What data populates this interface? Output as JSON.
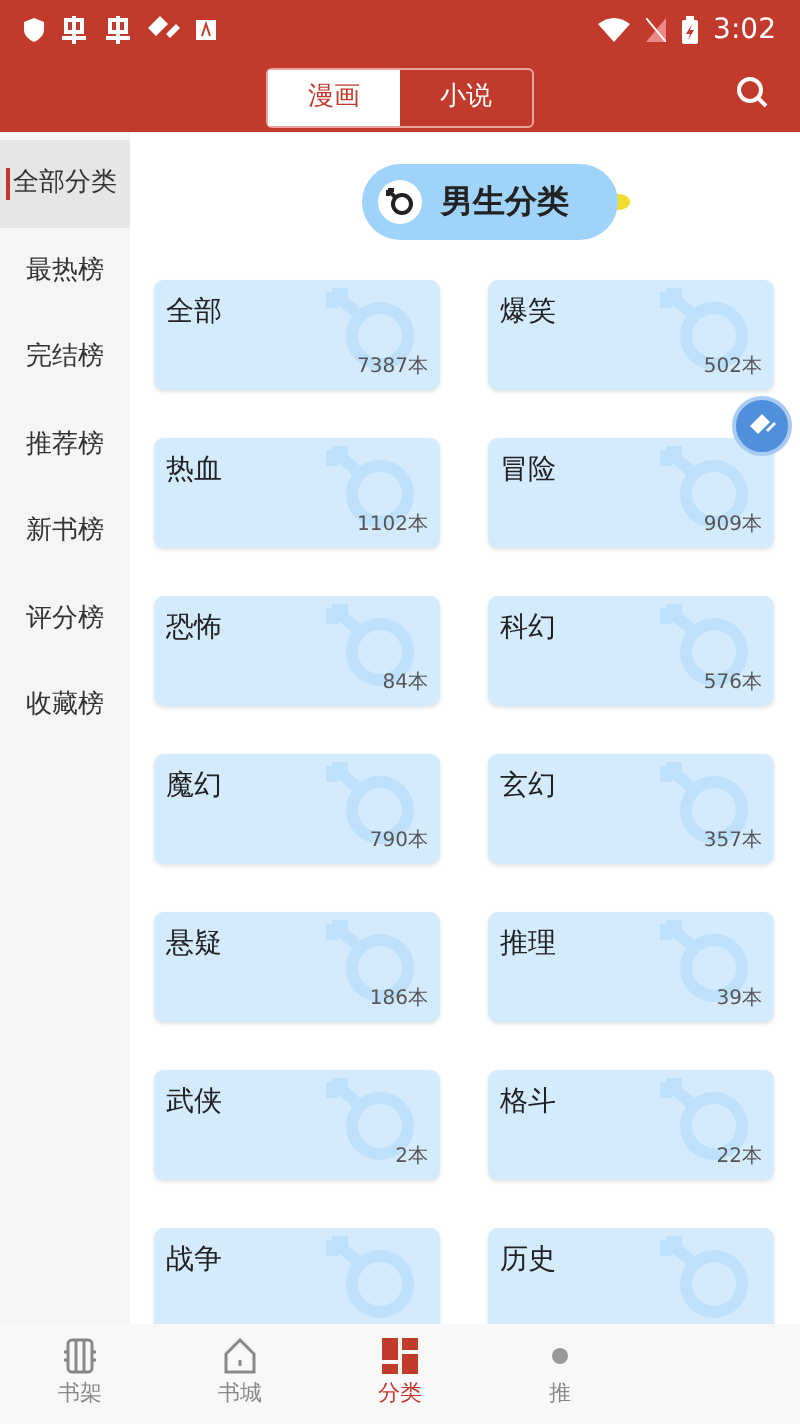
{
  "status_bar": {
    "time": "3:02"
  },
  "header": {
    "tabs": [
      {
        "label": "漫画",
        "selected": true
      },
      {
        "label": "小说",
        "selected": false
      }
    ]
  },
  "sidebar": {
    "items": [
      {
        "label": "全部分类",
        "selected": true
      },
      {
        "label": "最热榜",
        "selected": false
      },
      {
        "label": "完结榜",
        "selected": false
      },
      {
        "label": "推荐榜",
        "selected": false
      },
      {
        "label": "新书榜",
        "selected": false
      },
      {
        "label": "评分榜",
        "selected": false
      },
      {
        "label": "收藏榜",
        "selected": false
      }
    ]
  },
  "section_title": "男生分类",
  "categories": [
    {
      "name": "全部",
      "count": "7387本"
    },
    {
      "name": "爆笑",
      "count": "502本"
    },
    {
      "name": "热血",
      "count": "1102本"
    },
    {
      "name": "冒险",
      "count": "909本"
    },
    {
      "name": "恐怖",
      "count": "84本"
    },
    {
      "name": "科幻",
      "count": "576本"
    },
    {
      "name": "魔幻",
      "count": "790本"
    },
    {
      "name": "玄幻",
      "count": "357本"
    },
    {
      "name": "悬疑",
      "count": "186本"
    },
    {
      "name": "推理",
      "count": "39本"
    },
    {
      "name": "武侠",
      "count": "2本"
    },
    {
      "name": "格斗",
      "count": "22本"
    },
    {
      "name": "战争"
    },
    {
      "name": "历史"
    }
  ],
  "bottom_nav": [
    {
      "label": "书架",
      "kind": "shelf",
      "selected": false
    },
    {
      "label": "书城",
      "kind": "home",
      "selected": false
    },
    {
      "label": "分类",
      "kind": "grid",
      "selected": true
    },
    {
      "label": "推",
      "kind": "dot",
      "selected": false
    }
  ]
}
